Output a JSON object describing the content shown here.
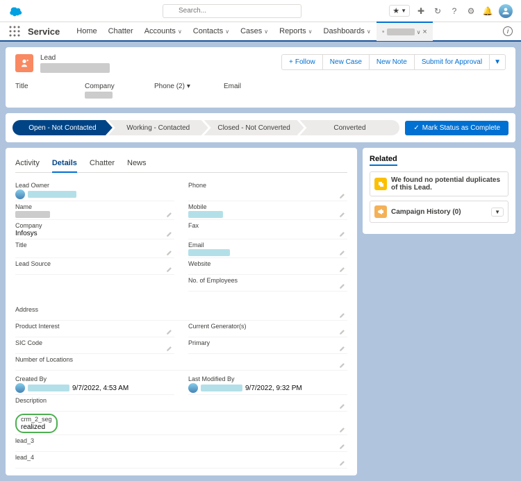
{
  "global": {
    "search_placeholder": "Search...",
    "star": "★",
    "plus": "✚",
    "history": "↻",
    "help": "?",
    "gear": "⚙",
    "bell": "🔔"
  },
  "nav": {
    "app_name": "Service",
    "items": [
      "Home",
      "Chatter",
      "Accounts",
      "Contacts",
      "Cases",
      "Reports",
      "Dashboards"
    ],
    "active_close": "×",
    "active_chev": "∨"
  },
  "record": {
    "type": "Lead",
    "buttons": {
      "follow": "Follow",
      "newcase": "New Case",
      "newnote": "New Note",
      "submit": "Submit for Approval",
      "caret": "▼"
    }
  },
  "highlights": {
    "title": "Title",
    "company": "Company",
    "phone": "Phone (2)",
    "phone_chev": "▾",
    "email": "Email"
  },
  "path": {
    "steps": [
      "Open - Not Contacted",
      "Working - Contacted",
      "Closed - Not Converted",
      "Converted"
    ],
    "mark_complete": "Mark Status as Complete",
    "check": "✓"
  },
  "tabs": {
    "activity": "Activity",
    "details": "Details",
    "chatter": "Chatter",
    "news": "News"
  },
  "fields": {
    "lead_owner": "Lead Owner",
    "phone": "Phone",
    "name": "Name",
    "mobile": "Mobile",
    "company": "Company",
    "company_val": "Infosys",
    "fax": "Fax",
    "title": "Title",
    "email": "Email",
    "lead_source": "Lead Source",
    "website": "Website",
    "employees": "No. of Employees",
    "address": "Address",
    "product_interest": "Product Interest",
    "current_gen": "Current Generator(s)",
    "sic": "SIC Code",
    "primary": "Primary",
    "locations": "Number of Locations",
    "created_by": "Created By",
    "created_date": "9/7/2022, 4:53 AM",
    "modified_by": "Last Modified By",
    "modified_date": "9/7/2022, 9:32 PM",
    "description": "Description",
    "crm2seg_label": "crm_2_seg",
    "crm2seg_val": "realized",
    "lead3": "lead_3",
    "lead4": "lead_4"
  },
  "related": {
    "title": "Related",
    "duplicates": "We found no potential duplicates of this Lead.",
    "campaign": "Campaign History (0)",
    "chev": "▼"
  }
}
